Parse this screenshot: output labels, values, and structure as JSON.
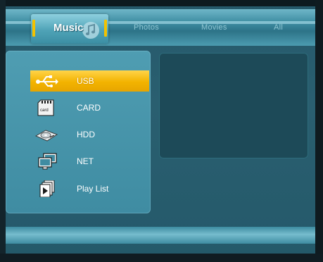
{
  "tabs": {
    "active": "Music",
    "others": [
      "Photos",
      "Movies",
      "All"
    ]
  },
  "sources": [
    {
      "label": "USB",
      "icon": "usb-icon",
      "selected": true
    },
    {
      "label": "CARD",
      "icon": "card-icon",
      "icon_text": "card",
      "selected": false
    },
    {
      "label": "HDD",
      "icon": "hdd-icon",
      "selected": false
    },
    {
      "label": "NET",
      "icon": "network-icon",
      "selected": false
    },
    {
      "label": "Play List",
      "icon": "playlist-icon",
      "selected": false
    }
  ],
  "colors": {
    "selection": "#f3b300",
    "background": "#25596b",
    "preview": "#1d4a58"
  }
}
